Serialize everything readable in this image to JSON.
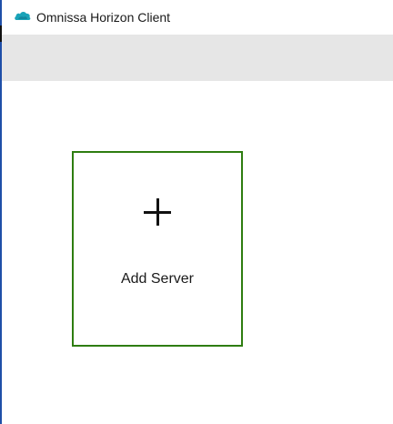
{
  "window": {
    "title": "Omnissa Horizon Client",
    "icon": "omnissa-cloud-icon"
  },
  "toolbar": {},
  "main": {
    "tiles": [
      {
        "label": "Add Server",
        "icon": "plus-icon"
      }
    ]
  },
  "colors": {
    "tile_border": "#2e7d10",
    "toolbar_bg": "#e6e6e6",
    "window_edge": "#1f4fa8",
    "icon_teal": "#1aa3b8"
  }
}
